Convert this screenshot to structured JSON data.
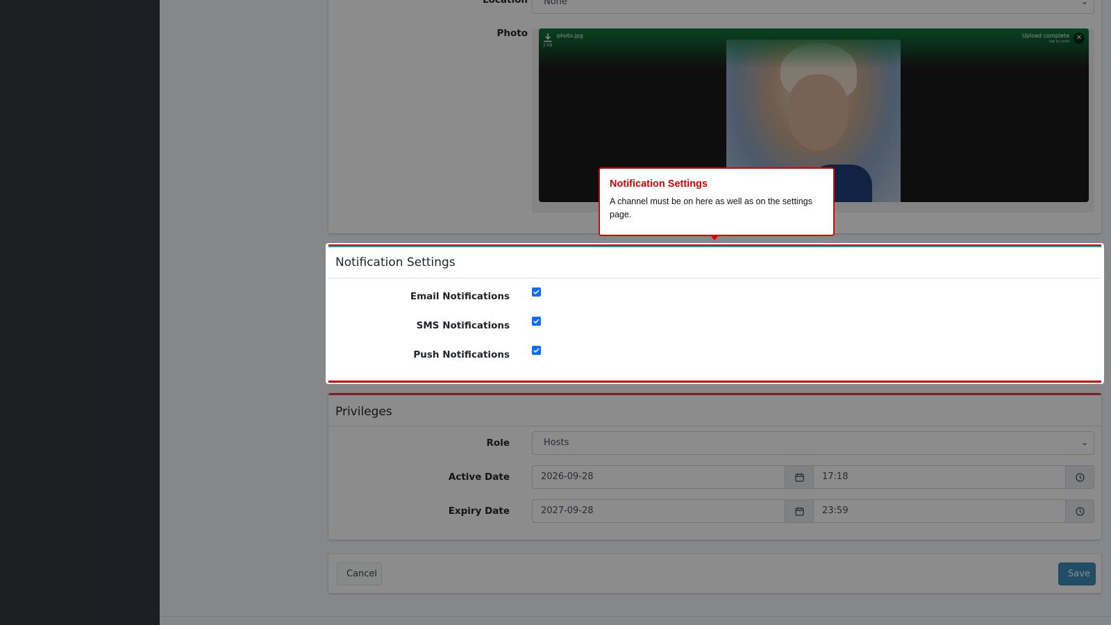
{
  "location": {
    "label": "Location",
    "value": "None"
  },
  "photo": {
    "label": "Photo",
    "file_name": "photo.jpg",
    "file_size": "2 KB",
    "status": "Upload complete",
    "hint": "tap to undo"
  },
  "notifications": {
    "title": "Notification Settings",
    "email_label": "Email Notifications",
    "sms_label": "SMS Notifications",
    "push_label": "Push Notifications",
    "email_checked": true,
    "sms_checked": true,
    "push_checked": true
  },
  "privileges": {
    "title": "Privileges",
    "role_label": "Role",
    "role_value": "Hosts",
    "active_label": "Active Date",
    "active_date": "2026-09-28",
    "active_time": "17:18",
    "expiry_label": "Expiry Date",
    "expiry_date": "2027-09-28",
    "expiry_time": "23:59"
  },
  "actions": {
    "cancel": "Cancel",
    "save": "Save"
  },
  "tooltip": {
    "title": "Notification Settings",
    "body": "A channel must be on here as well as on the settings page."
  },
  "colors": {
    "primary": "#3c8dbc",
    "info": "#17a2b8",
    "danger": "#dc3545",
    "highlight": "#e00000",
    "sidebar": "#343a40"
  }
}
